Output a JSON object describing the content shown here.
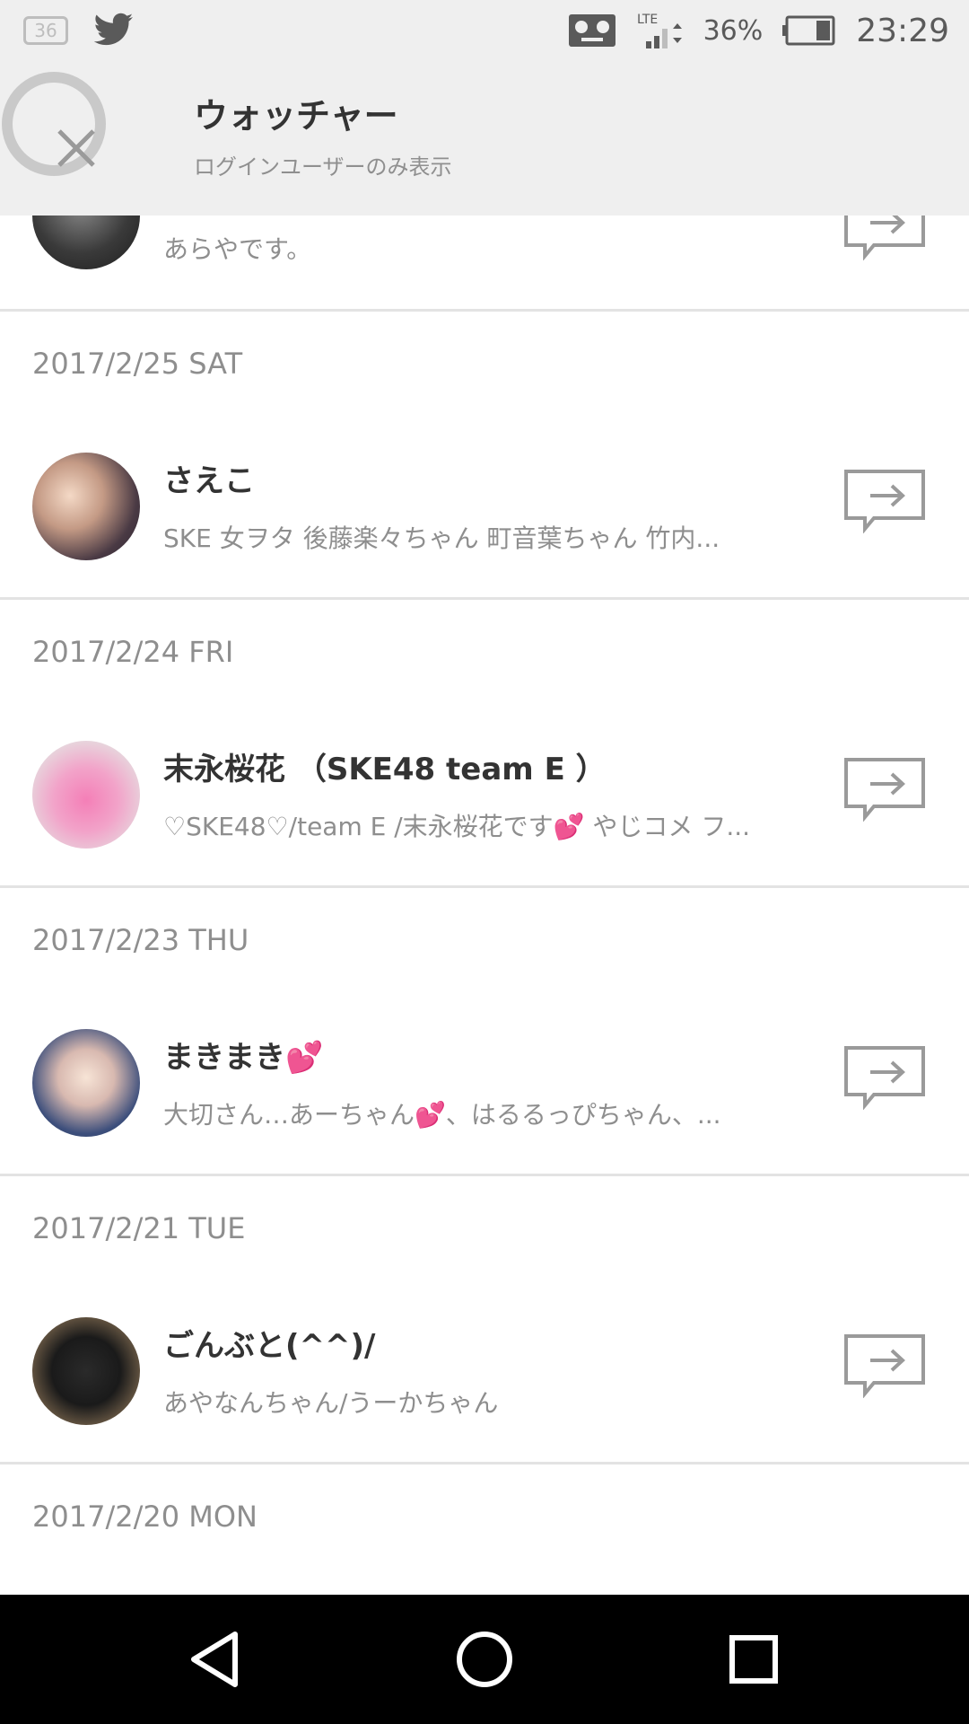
{
  "status_bar": {
    "notification_count": "36",
    "network": "LTE",
    "battery_percent": "36%",
    "time": "23:29",
    "icons": [
      "notification-badge-icon",
      "twitter-icon",
      "voicemail-icon",
      "lte-signal-icon",
      "battery-icon"
    ]
  },
  "header": {
    "title": "ウォッチャー",
    "subtitle": "ログインユーザーのみ表示",
    "close_icon": "close-icon"
  },
  "list": {
    "partial_item": {
      "bio": "あらやです。"
    },
    "sections": [
      {
        "date": "2017/2/25 SAT",
        "user": {
          "name": "さえこ",
          "bio": "SKE 女ヲタ 後藤楽々ちゃん 町音葉ちゃん 竹内..."
        }
      },
      {
        "date": "2017/2/24 FRI",
        "user": {
          "name": "末永桜花 （SKE48 team E ）",
          "bio": "♡SKE48♡/team E /末永桜花です💕 やじコメ フ..."
        }
      },
      {
        "date": "2017/2/23 THU",
        "user": {
          "name": "まきまき💕",
          "bio": "大切さん…あーちゃん💕、はるるっぴちゃん、..."
        }
      },
      {
        "date": "2017/2/21 TUE",
        "user": {
          "name": "ごんぶと(^^)/",
          "bio": "あやなんちゃん/うーかちゃん"
        }
      },
      {
        "date": "2017/2/20 MON"
      }
    ]
  },
  "colors": {
    "header_bg": "#efefef",
    "divider": "#e3e3e3",
    "text_primary": "#333333",
    "text_secondary": "#8e8e8e",
    "navbar_bg": "#000000"
  }
}
